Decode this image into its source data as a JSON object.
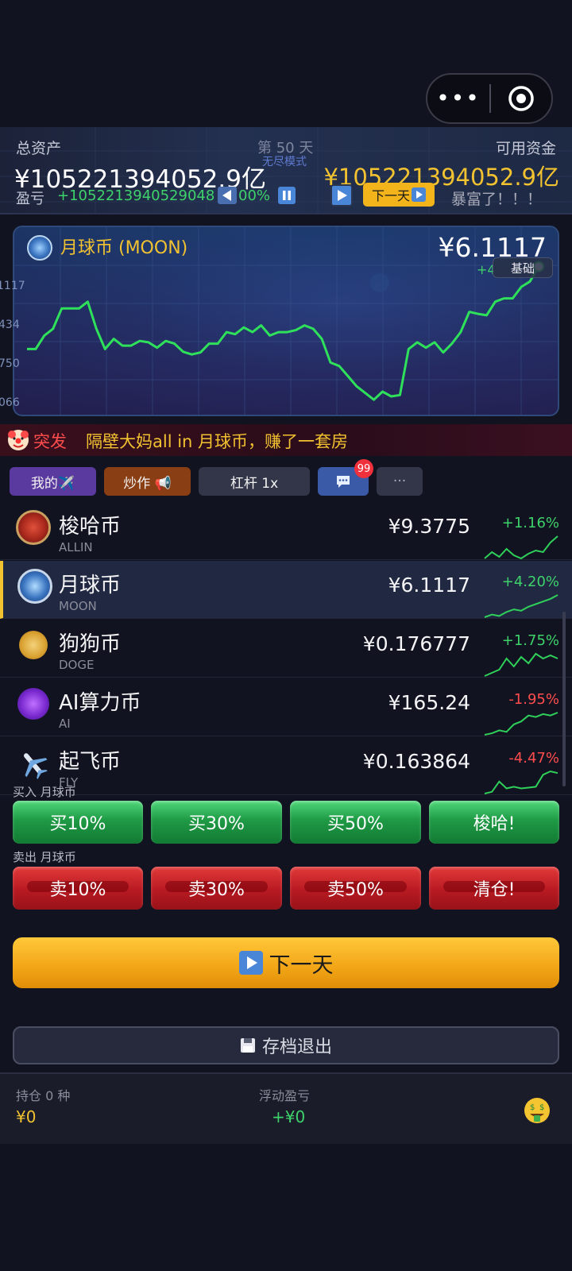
{
  "capsule": {
    "more": "•••"
  },
  "header": {
    "total_assets_label": "总资产",
    "day_label": "第 50 天",
    "mode_label": "无尽模式",
    "available_label": "可用资金",
    "total_assets_value": "¥105221394052.9亿",
    "available_value": "¥105221394052.9亿",
    "pnl_label": "盈亏",
    "pnl_value": "+1052213940529048",
    "pnl_pct": "00%",
    "next_day_small": "下一天",
    "rich_text": "暴富了！！！"
  },
  "chart_data": {
    "type": "line",
    "title": "月球币 (MOON)",
    "price": "¥6.1117",
    "change_hint": "+4",
    "base_label": "基础",
    "ytick_labels": [
      "1117",
      "434",
      "750",
      "066"
    ],
    "values": [
      4.6,
      4.6,
      4.8,
      4.9,
      5.2,
      5.2,
      5.2,
      5.3,
      4.9,
      4.6,
      4.75,
      4.65,
      4.65,
      4.72,
      4.7,
      4.62,
      4.72,
      4.68,
      4.56,
      4.52,
      4.55,
      4.68,
      4.68,
      4.85,
      4.82,
      4.92,
      4.85,
      4.95,
      4.8,
      4.85,
      4.85,
      4.88,
      4.95,
      4.9,
      4.75,
      4.4,
      4.35,
      4.2,
      4.05,
      3.95,
      3.85,
      3.97,
      3.9,
      3.92,
      4.6,
      4.7,
      4.62,
      4.7,
      4.55,
      4.68,
      4.85,
      5.15,
      5.12,
      5.1,
      5.3,
      5.35,
      5.35,
      5.52,
      5.6,
      5.82
    ],
    "ylim": [
      3.7,
      6.05
    ],
    "line_color": "#2fe05a"
  },
  "ticker": {
    "icon": "clown-face-icon",
    "tag": "突发",
    "text": "隔壁大妈all in 月球币，赚了一套房"
  },
  "tabs": {
    "mine": "我的✈️",
    "hype": "炒作 📢",
    "leverage": "杠杆 1x",
    "chat_badge": "99",
    "more": "···"
  },
  "coins": [
    {
      "name": "梭哈币",
      "symbol": "ALLIN",
      "price": "¥9.3775",
      "change": "+1.16%",
      "direction": "up",
      "icon": "allin-coin-icon",
      "spark": [
        3,
        3.4,
        3.1,
        3.6,
        3.2,
        3.0,
        3.3,
        3.5,
        3.4,
        4.0,
        4.4
      ]
    },
    {
      "name": "月球币",
      "symbol": "MOON",
      "price": "¥6.1117",
      "change": "+4.20%",
      "direction": "up",
      "icon": "moon-coin-icon",
      "spark": [
        2.9,
        3.0,
        2.95,
        3.1,
        3.2,
        3.15,
        3.3,
        3.4,
        3.5,
        3.6,
        3.75
      ]
    },
    {
      "name": "狗狗币",
      "symbol": "DOGE",
      "price": "¥0.176777",
      "change": "+1.75%",
      "direction": "up",
      "icon": "doge-coin-icon",
      "spark": [
        2.8,
        3.0,
        3.2,
        3.9,
        3.4,
        4.0,
        3.6,
        4.2,
        3.9,
        4.1,
        3.9
      ]
    },
    {
      "name": "AI算力币",
      "symbol": "AI",
      "price": "¥165.24",
      "change": "-1.95%",
      "direction": "down",
      "icon": "ai-coin-icon",
      "spark": [
        2.9,
        3.0,
        3.2,
        3.1,
        3.6,
        3.8,
        4.2,
        4.1,
        4.3,
        4.2,
        4.4
      ]
    },
    {
      "name": "起飞币",
      "symbol": "FLY",
      "price": "¥0.163864",
      "change": "-4.47%",
      "direction": "down",
      "icon": "airplane-icon",
      "spark": [
        2.8,
        2.9,
        3.5,
        3.1,
        3.2,
        3.1,
        3.15,
        3.2,
        3.9,
        4.1,
        4.0
      ]
    }
  ],
  "trade": {
    "buy_title": "买入 月球币",
    "sell_title": "卖出 月球币",
    "buy_buttons": [
      "买10%",
      "买30%",
      "买50%",
      "梭哈!"
    ],
    "sell_buttons": [
      "卖10%",
      "卖30%",
      "卖50%",
      "清仓!"
    ]
  },
  "next_day": "下一天",
  "save_exit": "存档退出",
  "footer": {
    "holding_label": "持仓 0 种",
    "holding_value": "¥0",
    "float_label": "浮动盈亏",
    "float_value": "+¥0",
    "icon": "money-face-icon"
  }
}
